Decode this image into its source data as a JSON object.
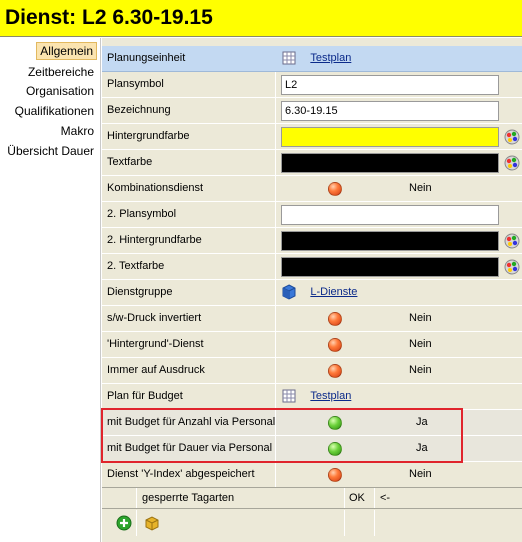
{
  "window": {
    "title": "Dienst: L2 6.30-19.15"
  },
  "sidebar": {
    "items": [
      {
        "label": "Allgemein",
        "active": true
      },
      {
        "label": "Zeitbereiche"
      },
      {
        "label": "Organisation"
      },
      {
        "label": "Qualifikationen"
      },
      {
        "label": "Makro"
      },
      {
        "label": "Übersicht Dauer"
      }
    ]
  },
  "colors": {
    "background_color": "#ffff00",
    "text_color": "#000000",
    "highlight_border": "#e0242c"
  },
  "properties": {
    "planungseinheit": {
      "label": "Planungseinheit",
      "value": "Testplan",
      "icon": "grid-icon"
    },
    "plansymbol": {
      "label": "Plansymbol",
      "value": "L2"
    },
    "bezeichnung": {
      "label": "Bezeichnung",
      "value": "6.30-19.15"
    },
    "hintergrundfarbe": {
      "label": "Hintergrundfarbe"
    },
    "textfarbe": {
      "label": "Textfarbe"
    },
    "kombinationsdienst": {
      "label": "Kombinationsdienst",
      "value": "Nein",
      "state": "red"
    },
    "plansymbol2": {
      "label": "2. Plansymbol",
      "value": ""
    },
    "hintergrundfarbe2": {
      "label": "2. Hintergrundfarbe"
    },
    "textfarbe2": {
      "label": "2. Textfarbe"
    },
    "dienstgruppe": {
      "label": "Dienstgruppe",
      "value": "L-Dienste",
      "icon": "cube-icon"
    },
    "sw_druck": {
      "label": "s/w-Druck invertiert",
      "value": "Nein",
      "state": "red"
    },
    "hintergrund_dienst": {
      "label": "'Hintergrund'-Dienst",
      "value": "Nein",
      "state": "red"
    },
    "immer_ausdruck": {
      "label": "Immer auf Ausdruck",
      "value": "Nein",
      "state": "red"
    },
    "plan_budget": {
      "label": "Plan für Budget",
      "value": "Testplan",
      "icon": "grid-icon"
    },
    "budget_anzahl": {
      "label": "mit Budget für Anzahl via Personal",
      "value": "Ja",
      "state": "green"
    },
    "budget_dauer": {
      "label": "mit Budget für Dauer via Personal",
      "value": "Ja",
      "state": "green"
    },
    "y_index": {
      "label": "Dienst 'Y-Index' abgespeichert",
      "value": "Nein",
      "state": "red"
    }
  },
  "subtable": {
    "headers": [
      "gesperrte Tagarten",
      "OK",
      "<-"
    ]
  }
}
